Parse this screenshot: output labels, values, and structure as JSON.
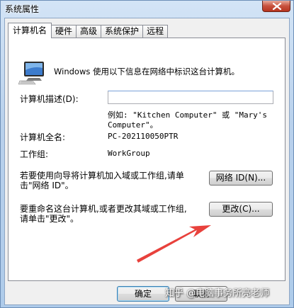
{
  "window": {
    "title": "系统属性"
  },
  "tabs": [
    {
      "label": "计算机名"
    },
    {
      "label": "硬件"
    },
    {
      "label": "高级"
    },
    {
      "label": "系统保护"
    },
    {
      "label": "远程"
    }
  ],
  "panel": {
    "intro": "Windows 使用以下信息在网络中标识这台计算机。",
    "description_label": "计算机描述(D):",
    "description_value": "",
    "example_line1": "例如: \"Kitchen Computer\" 或 \"Mary's",
    "example_line2": "Computer\"。",
    "fullname_label": "计算机全名:",
    "fullname_value": "PC-202110050PTR",
    "workgroup_label": "工作组:",
    "workgroup_value": "WorkGroup",
    "network_text_line1": "若要使用向导将计算机加入域或工作组,请单",
    "network_text_line2": "击\"网络 ID\"。",
    "network_button": "网络 ID(N)...",
    "rename_text_line1": "要重命名这台计算机,或者更改其域或工作组,",
    "rename_text_line2": "请单击\"更改\"。",
    "change_button": "更改(C)..."
  },
  "footer": {
    "ok_button": "确定",
    "cancel_button": "取消"
  },
  "watermark": "知乎 @电脑事务所亮老师",
  "colors": {
    "arrow": "#e8413c"
  }
}
